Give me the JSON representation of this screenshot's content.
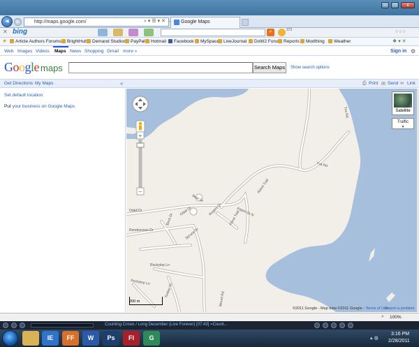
{
  "browser": {
    "url": "http://maps.google.com/",
    "tab_title": "Google Maps",
    "window_controls": {
      "minimize": "–",
      "maximize": "□",
      "close": "x"
    }
  },
  "bing_toolbar": {
    "logo": "bing",
    "badge_count": "373"
  },
  "favorites": {
    "items": [
      "Article Authors Forums",
      "BrightHub",
      "Demand Studios",
      "PayPal",
      "Hotmail",
      "Facebook",
      "MySpace",
      "LiveJournal",
      "DoW2 Forum",
      "Reports",
      "Modthing",
      "Weather"
    ]
  },
  "google_bar": {
    "links": [
      "Web",
      "Images",
      "Videos",
      "Maps",
      "News",
      "Shopping",
      "Gmail",
      "more »"
    ],
    "active": "Maps",
    "sign_in": "Sign in"
  },
  "search": {
    "logo_google": "Google",
    "logo_maps": "maps",
    "button": "Search Maps",
    "options": "Show search options",
    "value": ""
  },
  "subbar": {
    "get_directions": "Get Directions",
    "my_maps": "My Maps",
    "print": "Print",
    "send": "Send",
    "link": "Link",
    "collapse": "«"
  },
  "left_panel": {
    "set_default": "Set default location",
    "business_prefix": "Put ",
    "business_link": "your business on Google Maps"
  },
  "map": {
    "satellite": "Satellite",
    "traffic": "Traffic",
    "scale": "200 m",
    "copyright": "©2011 Google - Map data ©2011 Google - ",
    "terms": "Terms of Use",
    "report": "Report a problem",
    "streets": [
      "Tva Rd",
      "Tva Rd",
      "Klone Trail",
      "Odell Dr",
      "Odell Dr",
      "Rendezvous Dr",
      "Spruce Dr",
      "Rockytop Ln",
      "Rockytop Ln",
      "Timber Dr",
      "Klone Trail",
      "Aspen Dr N",
      "Rogers Dr",
      "Birch Dr",
      "Bear Dr",
      "Mount Rd"
    ],
    "colors": {
      "water": "#a5bfdd",
      "land": "#f2efe9",
      "road": "#ffffff",
      "road_edge": "#b8b2a8"
    }
  },
  "statusbar": {
    "zoom": "100%"
  },
  "media_player": {
    "track": "Counting Crows / Long December (Live Forever) [07:43]  =Count..."
  },
  "taskbar": {
    "apps": [
      "IE",
      "FF",
      "W",
      "Ps",
      "Fl",
      "G"
    ],
    "time": "3:16 PM",
    "date": "2/28/2011"
  }
}
